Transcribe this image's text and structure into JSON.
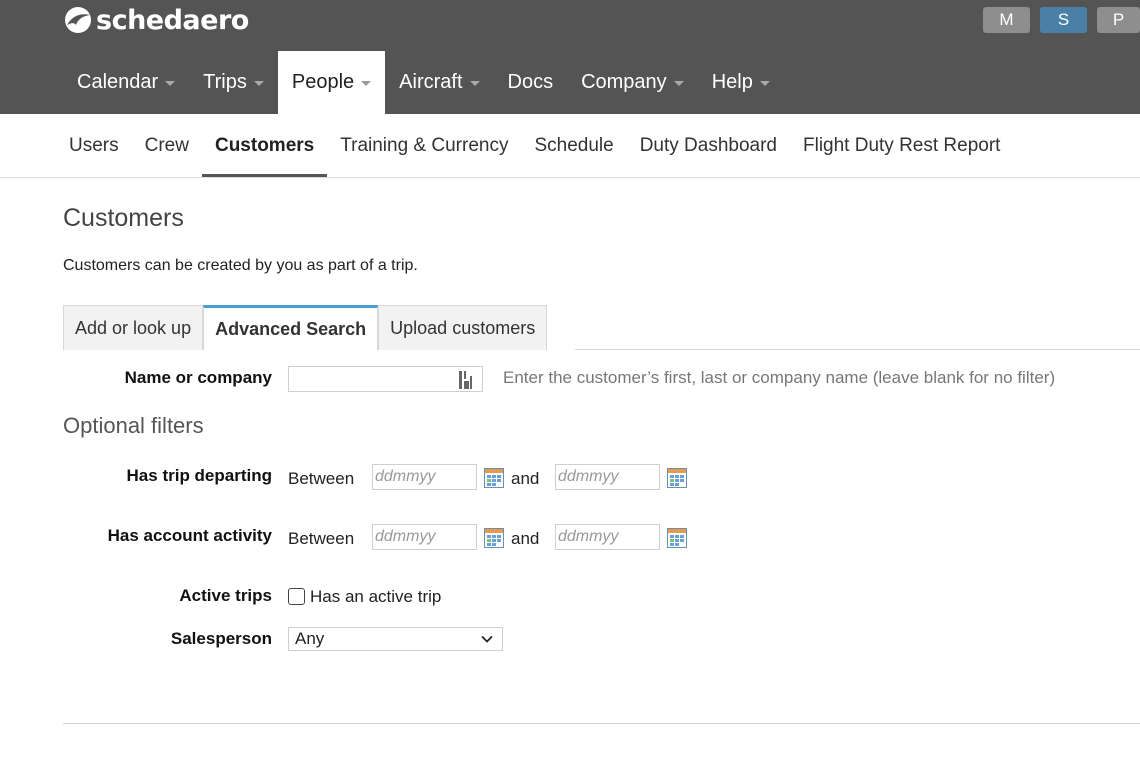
{
  "brand": {
    "name": "schedaero",
    "logo_icon": "bird-logo-icon"
  },
  "user_buttons": [
    "M",
    "S",
    "P"
  ],
  "main_nav": [
    {
      "label": "Calendar",
      "dropdown": true
    },
    {
      "label": "Trips",
      "dropdown": true
    },
    {
      "label": "People",
      "dropdown": true,
      "active": true
    },
    {
      "label": "Aircraft",
      "dropdown": true
    },
    {
      "label": "Docs",
      "dropdown": false
    },
    {
      "label": "Company",
      "dropdown": true
    },
    {
      "label": "Help",
      "dropdown": true
    }
  ],
  "sub_nav": [
    {
      "label": "Users"
    },
    {
      "label": "Crew"
    },
    {
      "label": "Customers",
      "active": true
    },
    {
      "label": "Training & Currency"
    },
    {
      "label": "Schedule"
    },
    {
      "label": "Duty Dashboard"
    },
    {
      "label": "Flight Duty Rest Report"
    }
  ],
  "page": {
    "title": "Customers",
    "description": "Customers can be created by you as part of a trip."
  },
  "tabs": [
    {
      "label": "Add or look up"
    },
    {
      "label": "Advanced Search",
      "active": true
    },
    {
      "label": "Upload customers"
    }
  ],
  "form": {
    "name_label": "Name or company",
    "name_value": "",
    "name_hint": "Enter the customer’s first, last or company name (leave blank for no filter)",
    "optional_title": "Optional filters",
    "trip_departing": {
      "label": "Has trip departing",
      "between": "Between",
      "and": "and",
      "from_placeholder": "ddmmyy",
      "to_placeholder": "ddmmyy"
    },
    "account_activity": {
      "label": "Has account activity",
      "between": "Between",
      "and": "and",
      "from_placeholder": "ddmmyy",
      "to_placeholder": "ddmmyy"
    },
    "active_trips": {
      "label": "Active trips",
      "checkbox_label": "Has an active trip",
      "checked": false
    },
    "salesperson": {
      "label": "Salesperson",
      "selected": "Any"
    }
  },
  "colors": {
    "header_bg": "#545454",
    "active_user": "#4a7fa6",
    "tab_accent": "#4a9bd0"
  }
}
